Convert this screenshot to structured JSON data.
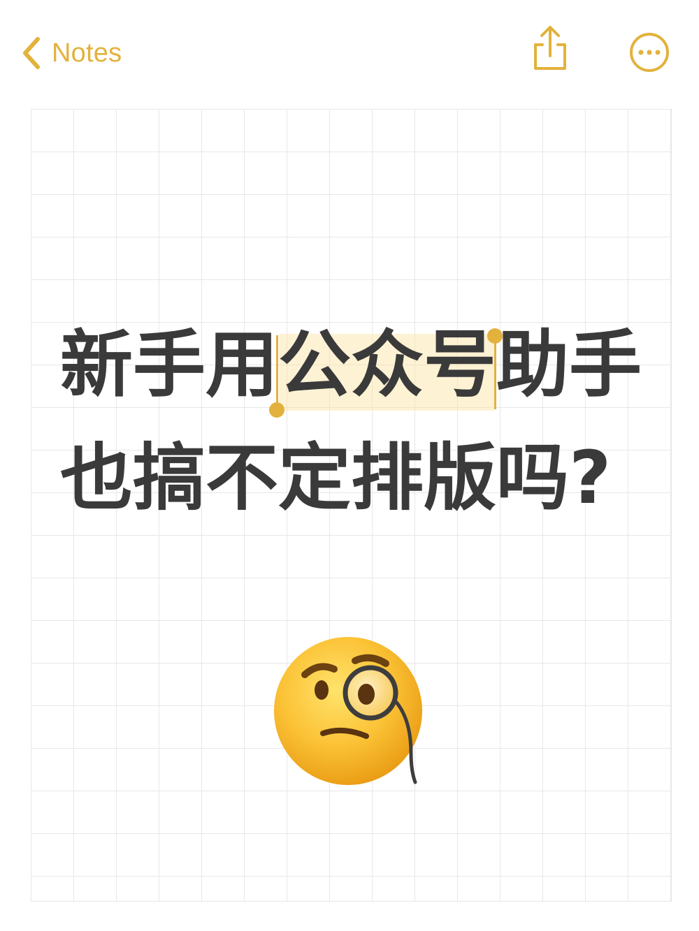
{
  "header": {
    "back_label": "Notes",
    "back_icon": "chevron-left-icon",
    "share_icon": "share-icon",
    "more_icon": "ellipsis-circle-icon"
  },
  "note": {
    "line1_before": "新手用",
    "line1_selected": "公众号",
    "line1_after": "助手",
    "line2": "也搞不定排版吗?",
    "emoji": "face-with-monocle-icon"
  },
  "colors": {
    "accent": "#E2B23C",
    "text": "#3a3a3a",
    "grid": "#e7e7e7",
    "selection": "#FAE2A0"
  }
}
